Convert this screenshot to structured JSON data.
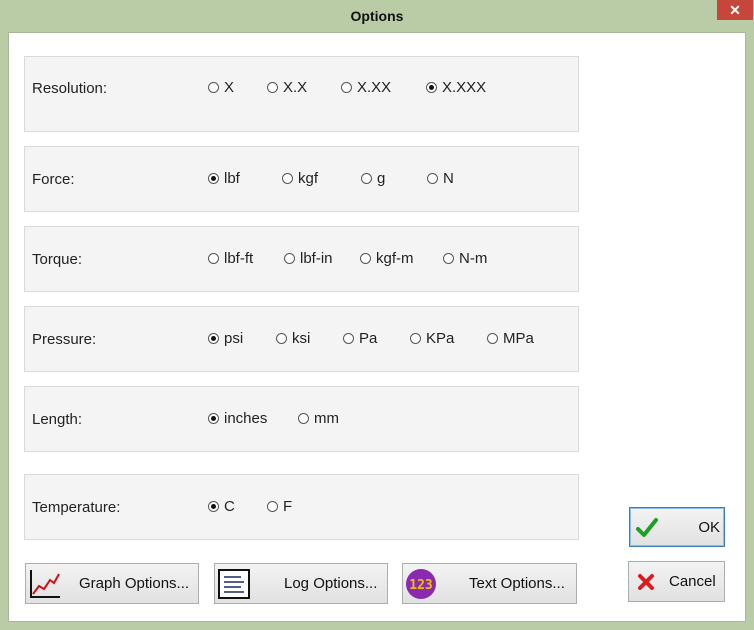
{
  "window": {
    "title": "Options",
    "close_glyph": "✕"
  },
  "groups": {
    "resolution": {
      "label": "Resolution:",
      "options": [
        "X",
        "X.X",
        "X.XX",
        "X.XXX"
      ],
      "selected": 3
    },
    "force": {
      "label": "Force:",
      "options": [
        "lbf",
        "kgf",
        "g",
        "N"
      ],
      "selected": 0
    },
    "torque": {
      "label": "Torque:",
      "options": [
        "lbf-ft",
        "lbf-in",
        "kgf-m",
        "N-m"
      ],
      "selected": -1
    },
    "pressure": {
      "label": "Pressure:",
      "options": [
        "psi",
        "ksi",
        "Pa",
        "KPa",
        "MPa"
      ],
      "selected": 0
    },
    "length": {
      "label": "Length:",
      "options": [
        "inches",
        "mm"
      ],
      "selected": 0
    },
    "temperature": {
      "label": "Temperature:",
      "options": [
        "C",
        "F"
      ],
      "selected": 0
    }
  },
  "buttons": {
    "ok": {
      "label": "OK",
      "icon": "checkmark-icon"
    },
    "cancel": {
      "label": "Cancel",
      "icon": "red-x-icon"
    },
    "graph": {
      "label": "Graph Options...",
      "icon": "line-chart-icon"
    },
    "log": {
      "label": "Log Options...",
      "icon": "document-lines-icon"
    },
    "text": {
      "label": "Text Options...",
      "icon": "digital-123-icon",
      "icon_text": "123"
    }
  },
  "colors": {
    "titlebar": "#b9cca6",
    "close": "#c7463b",
    "ok_check": "#1f9e24",
    "cancel_x": "#d81e1e",
    "chart_line": "#d01010",
    "text_icon_bg": "#8a2ab0",
    "text_icon_digits": "#f0c000"
  }
}
